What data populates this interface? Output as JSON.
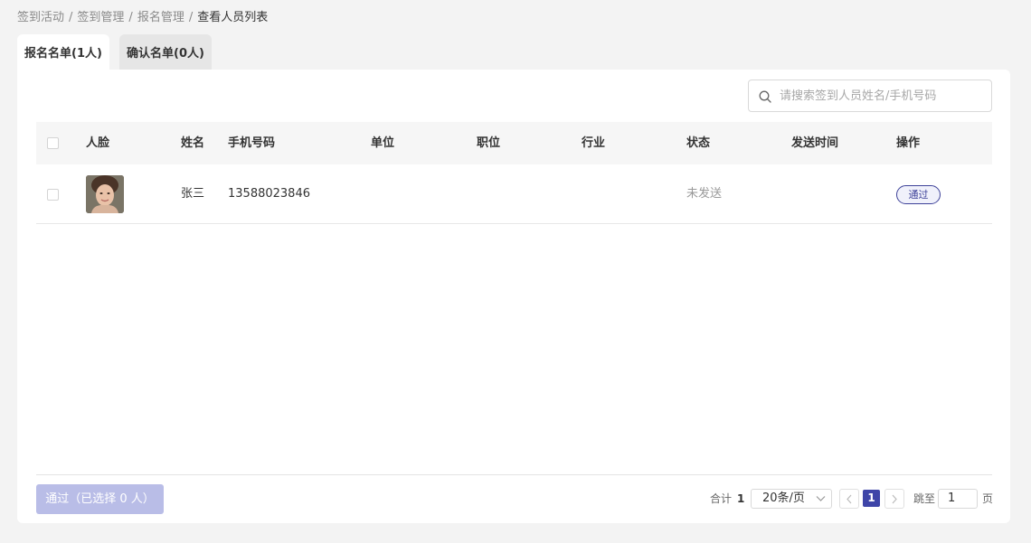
{
  "breadcrumb": {
    "items": [
      "签到活动",
      "签到管理",
      "报名管理"
    ],
    "current": "查看人员列表",
    "separator": "/"
  },
  "tabs": [
    {
      "label": "报名名单(1人)",
      "active": true
    },
    {
      "label": "确认名单(0人)",
      "active": false
    }
  ],
  "search": {
    "placeholder": "请搜索签到人员姓名/手机号码",
    "value": ""
  },
  "table": {
    "columns": [
      "人脸",
      "姓名",
      "手机号码",
      "单位",
      "职位",
      "行业",
      "状态",
      "发送时间",
      "操作"
    ],
    "rows": [
      {
        "name": "张三",
        "phone": "13588023846",
        "unit": "",
        "position": "",
        "industry": "",
        "status": "未发送",
        "send_time": "",
        "action": "通过"
      }
    ]
  },
  "footer": {
    "batch_button": "通过（已选择 0 人）",
    "total_label": "合计",
    "total_value": "1",
    "page_size": "20条/页",
    "current_page": "1",
    "jump_label": "跳至",
    "jump_value": "1",
    "page_unit": "页"
  },
  "colors": {
    "accent": "#3e45a8",
    "accent_disabled": "#b9bde7",
    "background": "#f3f3f3"
  },
  "icons": [
    "search-icon",
    "chevron-down-icon",
    "chevron-left-icon",
    "chevron-right-icon"
  ]
}
